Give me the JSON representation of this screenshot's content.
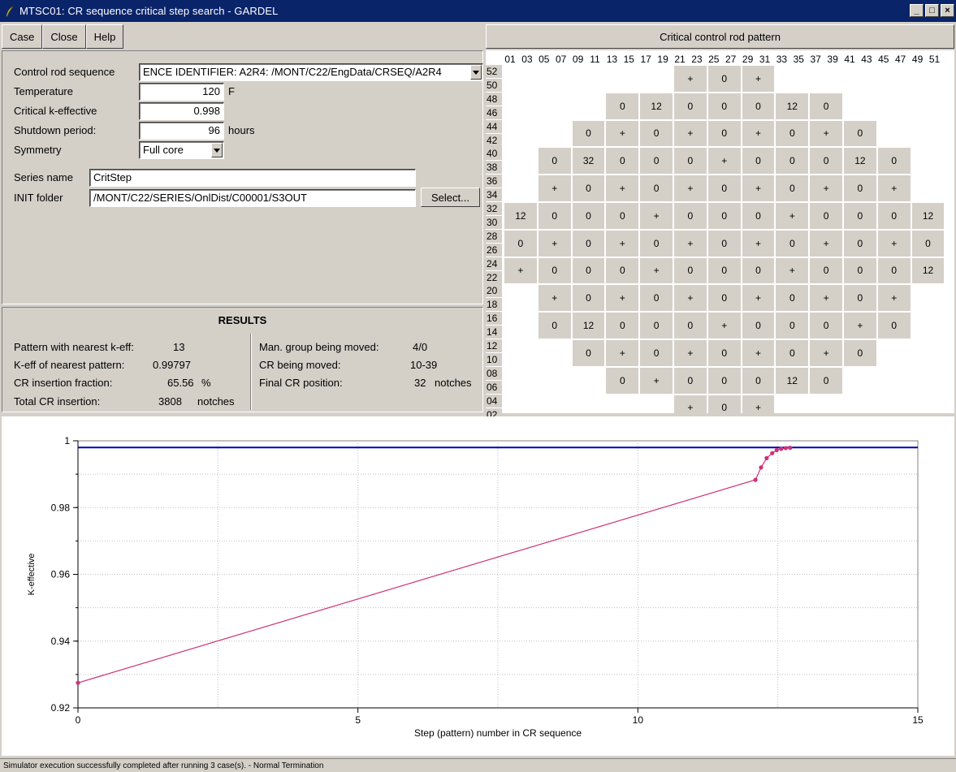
{
  "window": {
    "title": "MTSC01: CR sequence critical step search - GARDEL",
    "min_glyph": "_",
    "max_glyph": "□",
    "close_glyph": "×"
  },
  "menu": {
    "case": "Case",
    "close": "Close",
    "help": "Help"
  },
  "inputs": {
    "sequence_label": "Control rod sequence",
    "sequence_value": "ENCE IDENTIFIER: A2R4: /MONT/C22/EngData/CRSEQ/A2R4",
    "temperature_label": "Temperature",
    "temperature_value": "120",
    "temperature_unit": "F",
    "keff_label": "Critical k-effective",
    "keff_value": "0.998",
    "shutdown_label": "Shutdown period:",
    "shutdown_value": "96",
    "shutdown_unit": "hours",
    "symmetry_label": "Symmetry",
    "symmetry_value": "Full core",
    "series_label": "Series name",
    "series_value": "CritStep",
    "init_label": "INIT folder",
    "init_value": "/MONT/C22/SERIES/OnlDist/C00001/S3OUT",
    "select_label": "Select..."
  },
  "results": {
    "title": "RESULTS",
    "pattern_label": "Pattern with nearest k-eff:",
    "pattern_value": "13",
    "keff_label": "K-eff of nearest pattern:",
    "keff_value": "0.99797",
    "frac_label": "CR insertion fraction:",
    "frac_value": "65.56",
    "frac_unit": "%",
    "total_label": "Total CR insertion:",
    "total_value": "3808",
    "total_unit": "notches",
    "group_label": "Man. group being moved:",
    "group_value": "4/0",
    "cr_label": "CR being moved:",
    "cr_value": "10-39",
    "final_label": "Final CR position:",
    "final_value": "32",
    "final_unit": "notches"
  },
  "pattern": {
    "title": "Critical control rod pattern",
    "columns": [
      "01",
      "03",
      "05",
      "07",
      "09",
      "11",
      "13",
      "15",
      "17",
      "19",
      "21",
      "23",
      "25",
      "27",
      "29",
      "31",
      "33",
      "35",
      "37",
      "39",
      "41",
      "43",
      "45",
      "47",
      "49",
      "51"
    ],
    "rows": [
      "52",
      "50",
      "48",
      "46",
      "44",
      "42",
      "40",
      "38",
      "36",
      "34",
      "32",
      "30",
      "28",
      "26",
      "24",
      "22",
      "20",
      "18",
      "16",
      "14",
      "12",
      "10",
      "08",
      "06",
      "04",
      "02"
    ],
    "grid": [
      {
        "c": 10,
        "v": [
          "+",
          "0",
          "+"
        ]
      },
      {
        "c": 6,
        "v": [
          "0",
          "12",
          "0",
          "0",
          "0",
          "12",
          "0"
        ]
      },
      {
        "c": 4,
        "v": [
          "0",
          "+",
          "0",
          "+",
          "0",
          "+",
          "0",
          "+",
          "0"
        ]
      },
      {
        "c": 2,
        "v": [
          "0",
          "32",
          "0",
          "0",
          "0",
          "+",
          "0",
          "0",
          "0",
          "12",
          "0"
        ]
      },
      {
        "c": 2,
        "v": [
          "+",
          "0",
          "+",
          "0",
          "+",
          "0",
          "+",
          "0",
          "+",
          "0",
          "+"
        ]
      },
      {
        "c": 0,
        "v": [
          "12",
          "0",
          "0",
          "0",
          "+",
          "0",
          "0",
          "0",
          "+",
          "0",
          "0",
          "0",
          "12"
        ]
      },
      {
        "c": 0,
        "v": [
          "0",
          "+",
          "0",
          "+",
          "0",
          "+",
          "0",
          "+",
          "0",
          "+",
          "0",
          "+",
          "0"
        ]
      },
      {
        "c": 0,
        "v": [
          "+",
          "0",
          "0",
          "0",
          "+",
          "0",
          "0",
          "0",
          "+",
          "0",
          "0",
          "0",
          "12"
        ]
      },
      {
        "c": 2,
        "v": [
          "+",
          "0",
          "+",
          "0",
          "+",
          "0",
          "+",
          "0",
          "+",
          "0",
          "+"
        ]
      },
      {
        "c": 2,
        "v": [
          "0",
          "12",
          "0",
          "0",
          "0",
          "+",
          "0",
          "0",
          "0",
          "+",
          "0"
        ]
      },
      {
        "c": 4,
        "v": [
          "0",
          "+",
          "0",
          "+",
          "0",
          "+",
          "0",
          "+",
          "0"
        ]
      },
      {
        "c": 6,
        "v": [
          "0",
          "+",
          "0",
          "0",
          "0",
          "12",
          "0"
        ]
      },
      {
        "c": 10,
        "v": [
          "+",
          "0",
          "+"
        ]
      }
    ]
  },
  "chart_data": {
    "type": "line",
    "xlabel": "Step (pattern) number in CR sequence",
    "ylabel": "K-effective",
    "xlim": [
      0,
      15
    ],
    "ylim": [
      0.92,
      1.0
    ],
    "xticks": [
      0,
      5,
      10,
      15
    ],
    "yticks": [
      0.92,
      0.94,
      0.96,
      0.98,
      1.0
    ],
    "ytick_labels": [
      "0.92",
      "0.94",
      "0.96",
      "0.98",
      "1"
    ],
    "grid": true,
    "target": 0.998,
    "series": [
      {
        "x": [
          0,
          12.1,
          12.2,
          12.3,
          12.4,
          12.48,
          12.56,
          12.64,
          12.72
        ],
        "y": [
          0.9275,
          0.9883,
          0.992,
          0.9948,
          0.9963,
          0.9972,
          0.9976,
          0.9978,
          0.9979
        ]
      }
    ],
    "colors": {
      "line": "#cc3377",
      "target": "#0000c0"
    }
  },
  "status": "Simulator execution successfully completed after running 3 case(s). - Normal Termination"
}
